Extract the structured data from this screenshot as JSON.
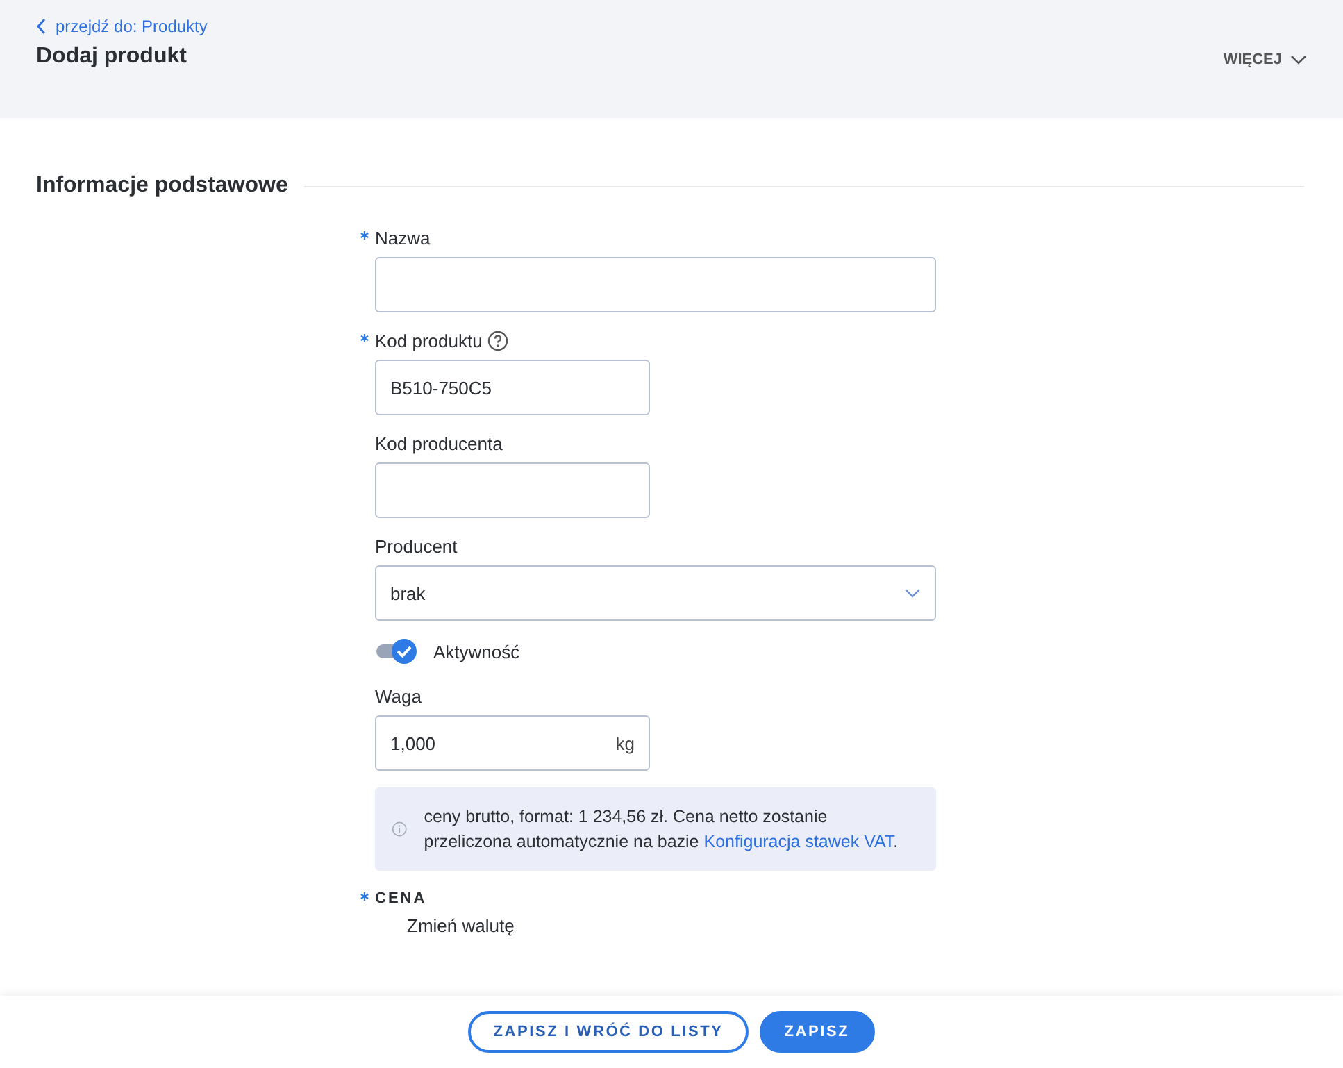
{
  "header": {
    "back_link": "przejdź do: Produkty",
    "title": "Dodaj produkt",
    "more_button": "WIĘCEJ"
  },
  "section": {
    "title": "Informacje podstawowe"
  },
  "fields": [
    {
      "kind": "wide",
      "label": "Nazwa",
      "required": true,
      "help": false
    },
    {
      "kind": "short",
      "label": "Kod produktu",
      "required": true,
      "help": true,
      "value": "B510-750C5"
    },
    {
      "kind": "short",
      "label": "Kod producenta",
      "required": false,
      "help": false
    },
    {
      "kind": "select",
      "label": "Producent",
      "required": false,
      "help": false,
      "value": "brak"
    },
    {
      "kind": "toggle",
      "label": "Aktywność",
      "on": true
    },
    {
      "kind": "unit",
      "label": "Waga",
      "required": false,
      "help": false,
      "value": "1,000",
      "unit": "kg"
    }
  ],
  "note": {
    "text": "ceny brutto, format: 1 234,56 zł. Cena netto zostanie przeliczona automatycznie na bazie",
    "link": "Konfiguracja stawek VAT",
    "end": "."
  },
  "price": {
    "label": "CENA",
    "required": true,
    "currency_link": "Zmień walutę"
  },
  "buttons": [
    {
      "label": "ZAPISZ I WRÓĆ DO LISTY",
      "kind": "secondary"
    },
    {
      "label": "ZAPISZ",
      "kind": "primary"
    }
  ]
}
